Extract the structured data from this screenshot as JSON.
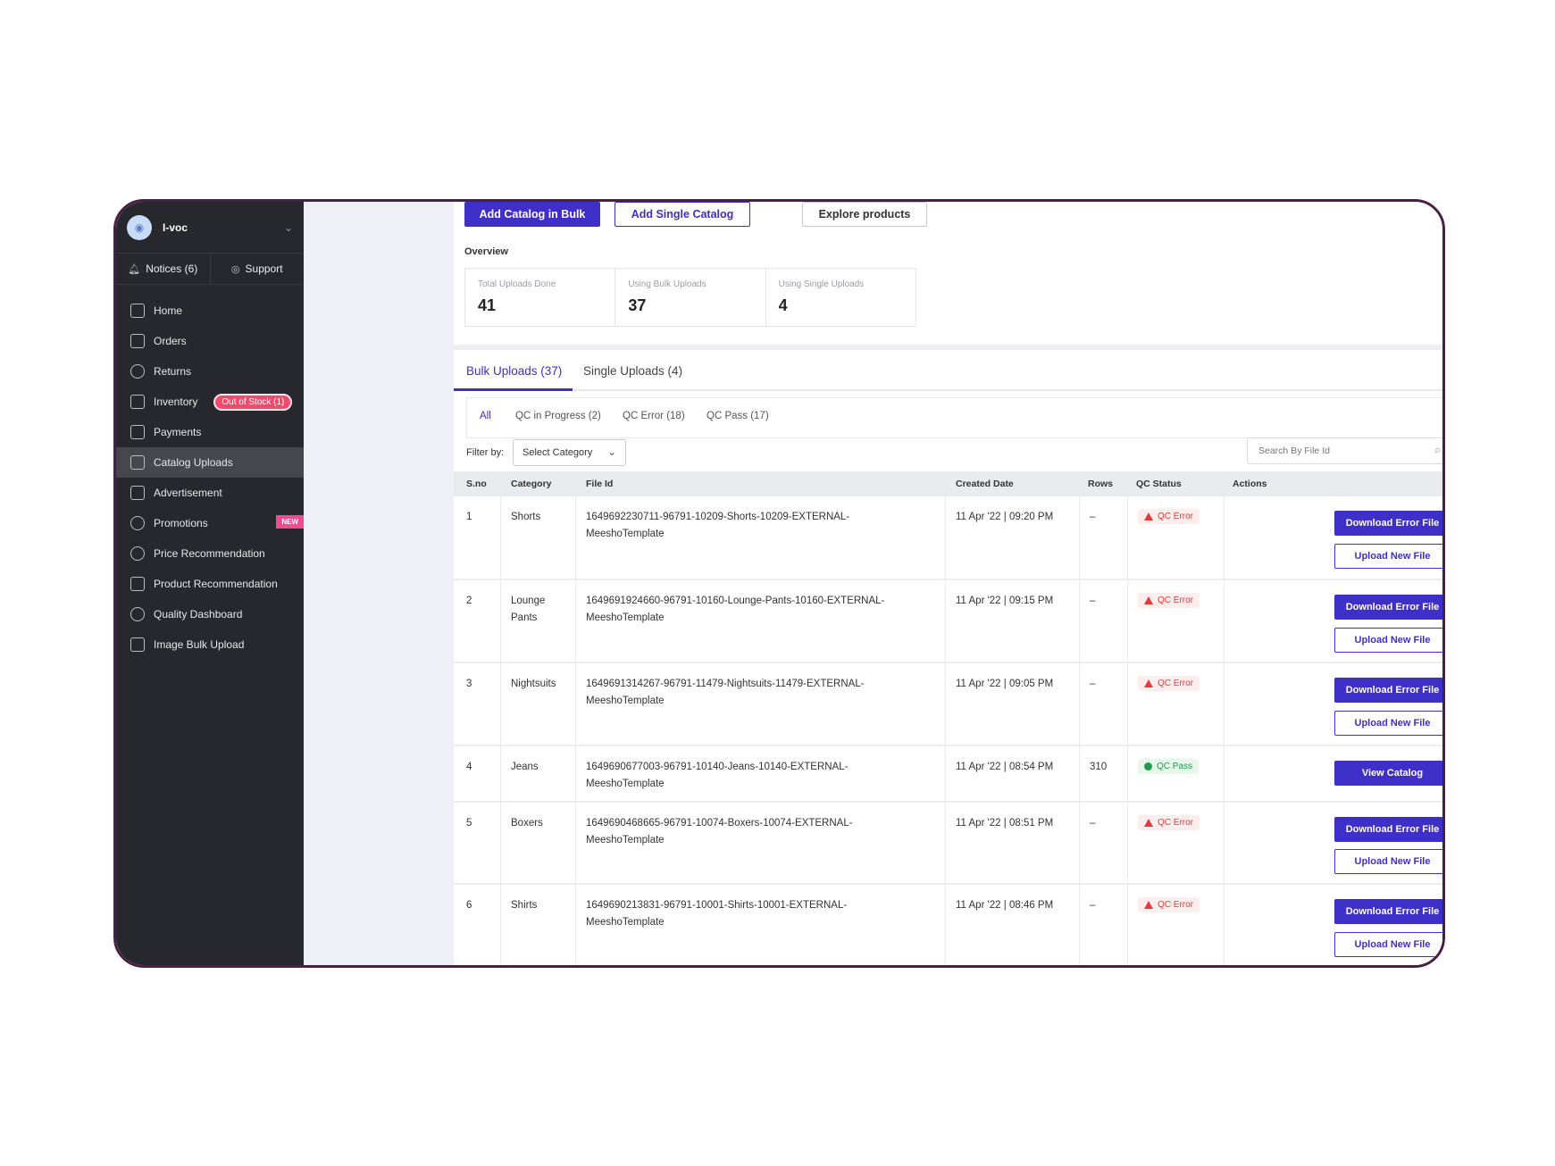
{
  "sidebar": {
    "account_name": "I-voc",
    "notices": "Notices (6)",
    "support": "Support",
    "items": [
      {
        "label": "Home"
      },
      {
        "label": "Orders"
      },
      {
        "label": "Returns"
      },
      {
        "label": "Inventory",
        "badge": "Out of Stock (1)"
      },
      {
        "label": "Payments"
      },
      {
        "label": "Catalog Uploads",
        "active": true
      },
      {
        "label": "Advertisement"
      },
      {
        "label": "Promotions",
        "badge": "NEW"
      },
      {
        "label": "Price Recommendation"
      },
      {
        "label": "Product Recommendation"
      },
      {
        "label": "Quality Dashboard"
      },
      {
        "label": "Image Bulk Upload"
      }
    ]
  },
  "toolbar": {
    "add_bulk": "Add Catalog in Bulk",
    "add_single": "Add Single Catalog",
    "explore": "Explore products"
  },
  "overview": {
    "title": "Overview",
    "stats": [
      {
        "label": "Total Uploads Done",
        "value": "41"
      },
      {
        "label": "Using Bulk Uploads",
        "value": "37"
      },
      {
        "label": "Using Single Uploads",
        "value": "4"
      }
    ]
  },
  "tabs": [
    "Bulk Uploads (37)",
    "Single Uploads (4)"
  ],
  "subtabs": [
    "All",
    "QC in Progress (2)",
    "QC Error (18)",
    "QC Pass (17)"
  ],
  "filter": {
    "label": "Filter by:",
    "category_value": "Select Category",
    "search_placeholder": "Search By File Id"
  },
  "table": {
    "headers": [
      "S.no",
      "Category",
      "File Id",
      "Created Date",
      "Rows",
      "QC Status",
      "Actions"
    ],
    "rows": [
      {
        "sno": "1",
        "category": "Shorts",
        "file_id_1": "1649692230711-96791-10209-Shorts-10209-EXTERNAL-",
        "file_id_2": "MeeshoTemplate",
        "date": "11 Apr '22 | 09:20 PM",
        "rows": "–",
        "qc": "QC Error",
        "action1": "Download Error File",
        "action2": "Upload New File"
      },
      {
        "sno": "2",
        "category": "Lounge Pants",
        "file_id_1": "1649691924660-96791-10160-Lounge-Pants-10160-EXTERNAL-",
        "file_id_2": "MeeshoTemplate",
        "date": "11 Apr '22 | 09:15 PM",
        "rows": "–",
        "qc": "QC Error",
        "action1": "Download Error File",
        "action2": "Upload New File"
      },
      {
        "sno": "3",
        "category": "Nightsuits",
        "file_id_1": "1649691314267-96791-11479-Nightsuits-11479-EXTERNAL-",
        "file_id_2": "MeeshoTemplate",
        "date": "11 Apr '22 | 09:05 PM",
        "rows": "–",
        "qc": "QC Error",
        "action1": "Download Error File",
        "action2": "Upload New File"
      },
      {
        "sno": "4",
        "category": "Jeans",
        "file_id_1": "1649690677003-96791-10140-Jeans-10140-EXTERNAL-",
        "file_id_2": "MeeshoTemplate",
        "date": "11 Apr '22 | 08:54 PM",
        "rows": "310",
        "qc": "QC Pass",
        "action1": "View Catalog"
      },
      {
        "sno": "5",
        "category": "Boxers",
        "file_id_1": "1649690468665-96791-10074-Boxers-10074-EXTERNAL-",
        "file_id_2": "MeeshoTemplate",
        "date": "11 Apr '22 | 08:51 PM",
        "rows": "–",
        "qc": "QC Error",
        "action1": "Download Error File",
        "action2": "Upload New File"
      },
      {
        "sno": "6",
        "category": "Shirts",
        "file_id_1": "1649690213831-96791-10001-Shirts-10001-EXTERNAL-",
        "file_id_2": "MeeshoTemplate",
        "date": "11 Apr '22 | 08:46 PM",
        "rows": "–",
        "qc": "QC Error",
        "action1": "Download Error File",
        "action2": "Upload New File"
      }
    ]
  }
}
